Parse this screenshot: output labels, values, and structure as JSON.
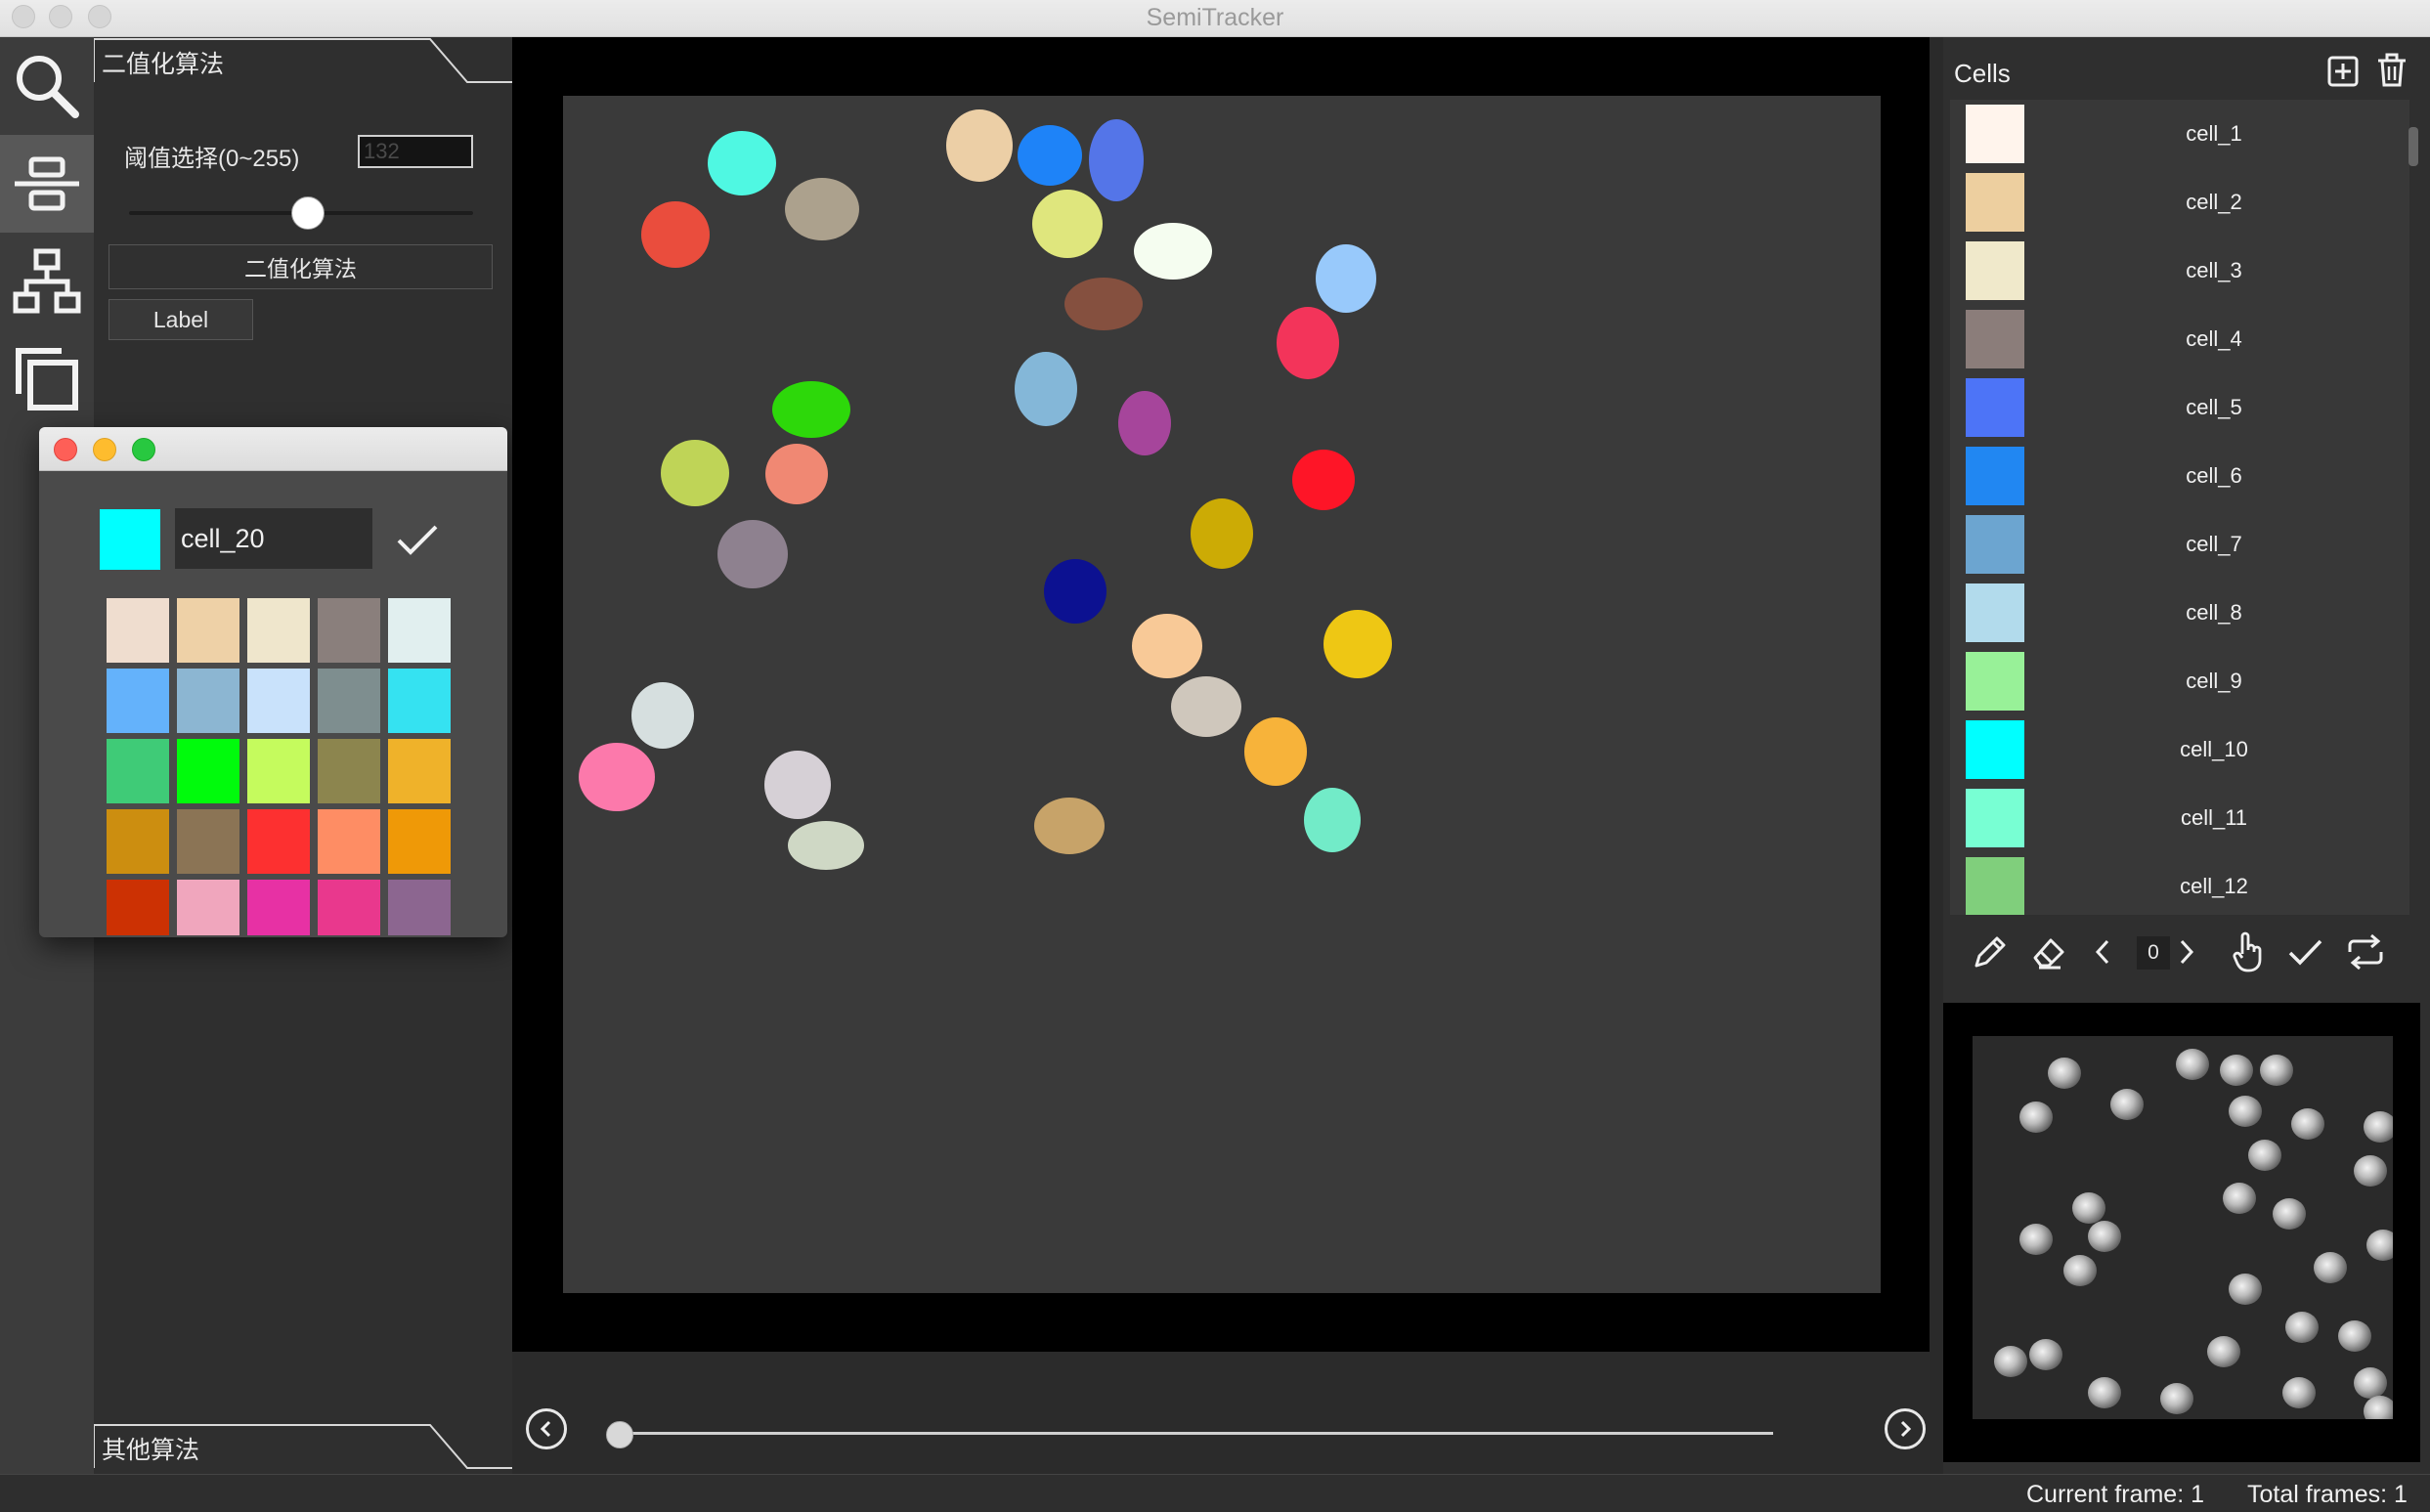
{
  "window": {
    "title": "SemiTracker"
  },
  "toolstrip": {
    "tools": [
      "search-icon",
      "align-center-icon",
      "hierarchy-icon",
      "layers-icon"
    ]
  },
  "left_panel": {
    "section_top": "二值化算法",
    "threshold_label": "阈值选择(0~255)",
    "threshold_value": "132",
    "threshold_slider": 132,
    "binarize_button": "二值化算法",
    "label_button": "Label",
    "section_bottom": "其他算法"
  },
  "canvas": {
    "frame_slider": {
      "value": 0,
      "max": 1
    },
    "cells": [
      {
        "color": "#4ff8e2"
      },
      {
        "color": "#eccfa6"
      },
      {
        "color": "#1e83f8"
      },
      {
        "color": "#5475e8"
      },
      {
        "color": "#ea4d3d"
      },
      {
        "color": "#aca18d"
      },
      {
        "color": "#dfe67d"
      },
      {
        "color": "#f5fdf0"
      },
      {
        "color": "#98c9fb"
      },
      {
        "color": "#85503f"
      },
      {
        "color": "#f3345a"
      },
      {
        "color": "#84b7d8"
      },
      {
        "color": "#a6459b"
      },
      {
        "color": "#2dd80a"
      },
      {
        "color": "#bfd457"
      },
      {
        "color": "#f08873"
      },
      {
        "color": "#fe1527"
      },
      {
        "color": "#ccab05"
      },
      {
        "color": "#8e818f"
      },
      {
        "color": "#0c1191"
      },
      {
        "color": "#f8c997"
      },
      {
        "color": "#eec714"
      },
      {
        "color": "#d6dfdf"
      },
      {
        "color": "#cfc7bc"
      },
      {
        "color": "#f7b33a"
      },
      {
        "color": "#fc79ab"
      },
      {
        "color": "#d6d0d6"
      },
      {
        "color": "#c7a369"
      },
      {
        "color": "#72ebc8"
      },
      {
        "color": "#cfd8c5"
      }
    ]
  },
  "right_panel": {
    "title": "Cells",
    "cells": [
      {
        "name": "cell_1",
        "color": "#fff4ec"
      },
      {
        "name": "cell_2",
        "color": "#edcf9f"
      },
      {
        "name": "cell_3",
        "color": "#f0e9cb"
      },
      {
        "name": "cell_4",
        "color": "#8b7d7a"
      },
      {
        "name": "cell_5",
        "color": "#4d74f7"
      },
      {
        "name": "cell_6",
        "color": "#2187f2"
      },
      {
        "name": "cell_7",
        "color": "#6ca5d0"
      },
      {
        "name": "cell_8",
        "color": "#b2dbec"
      },
      {
        "name": "cell_9",
        "color": "#98f198"
      },
      {
        "name": "cell_10",
        "color": "#00ffff"
      },
      {
        "name": "cell_11",
        "color": "#78ffd3"
      },
      {
        "name": "cell_12",
        "color": "#80cf7c"
      }
    ],
    "frame_index": "0"
  },
  "status": {
    "current_frame": "Current frame: 1",
    "total_frames": "Total frames: 1"
  },
  "dialog": {
    "selected_color": "#00ffff",
    "name_value": "cell_20",
    "palette": [
      "#efddcf",
      "#eed1a7",
      "#efe6cc",
      "#8a7f7c",
      "#e1efef",
      "#64b2fb",
      "#8cb6d2",
      "#c9e2fb",
      "#7e8e8f",
      "#35e2f1",
      "#3fcb77",
      "#00fb0c",
      "#c5fb5d",
      "#8c854e",
      "#efb22a",
      "#cc8e10",
      "#8b7455",
      "#fd3030",
      "#fe8d64",
      "#ef9907",
      "#cc3103",
      "#f0a6bd",
      "#e731a4",
      "#e9388d",
      "#8c6690"
    ]
  }
}
